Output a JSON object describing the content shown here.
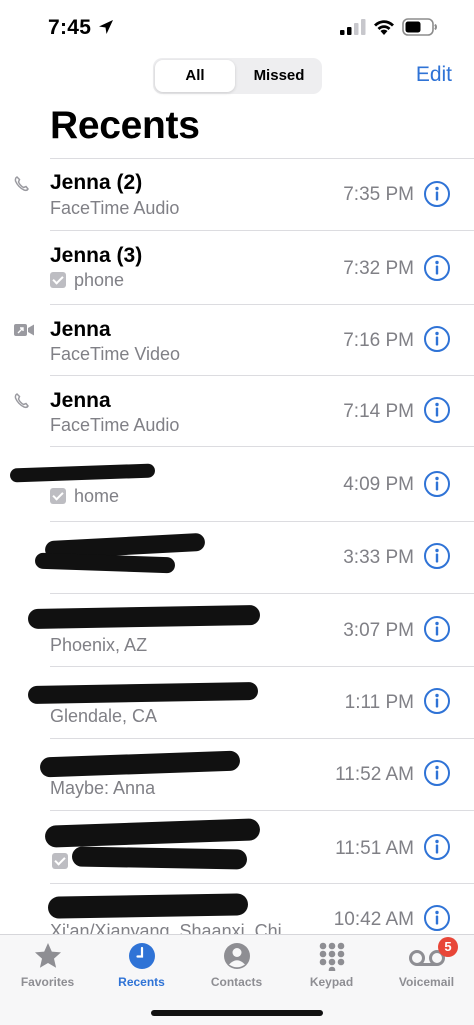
{
  "status_bar": {
    "time": "7:45"
  },
  "segmented": {
    "all_label": "All",
    "missed_label": "Missed"
  },
  "header": {
    "edit_label": "Edit",
    "title": "Recents"
  },
  "calls": [
    {
      "name": "Jenna (2)",
      "subtitle": "FaceTime Audio",
      "time": "7:35 PM",
      "type": "facetime-audio"
    },
    {
      "name": "Jenna (3)",
      "subtitle": "phone",
      "time": "7:32 PM",
      "type": "phone"
    },
    {
      "name": "Jenna",
      "subtitle": "FaceTime Video",
      "time": "7:16 PM",
      "type": "facetime-video"
    },
    {
      "name": "Jenna",
      "subtitle": "FaceTime Audio",
      "time": "7:14 PM",
      "type": "facetime-audio"
    },
    {
      "name": "",
      "subtitle": "home",
      "time": "4:09 PM",
      "type": "phone"
    },
    {
      "name": "",
      "subtitle": "",
      "time": "3:33 PM",
      "type": "phone"
    },
    {
      "name": "",
      "subtitle": "Phoenix, AZ",
      "time": "3:07 PM",
      "type": "phone"
    },
    {
      "name": "",
      "subtitle": "Glendale, CA",
      "time": "1:11 PM",
      "type": "phone"
    },
    {
      "name": "",
      "subtitle": "Maybe: Anna",
      "time": "11:52 AM",
      "type": "phone"
    },
    {
      "name": "",
      "subtitle": "",
      "time": "11:51 AM",
      "type": "phone"
    },
    {
      "name": "",
      "subtitle": "Xi'an/Xianyang, Shaanxi, Chi",
      "time": "10:42 AM",
      "type": "phone"
    }
  ],
  "tabs": [
    {
      "label": "Favorites",
      "icon": "star-icon"
    },
    {
      "label": "Recents",
      "icon": "clock-icon",
      "active": true
    },
    {
      "label": "Contacts",
      "icon": "person-icon"
    },
    {
      "label": "Keypad",
      "icon": "keypad-icon"
    },
    {
      "label": "Voicemail",
      "icon": "voicemail-icon",
      "badge": "5"
    }
  ],
  "colors": {
    "accent": "#2f73d6",
    "missed": "#e0453a",
    "secondary_text": "#808086",
    "badge": "#e84638"
  }
}
